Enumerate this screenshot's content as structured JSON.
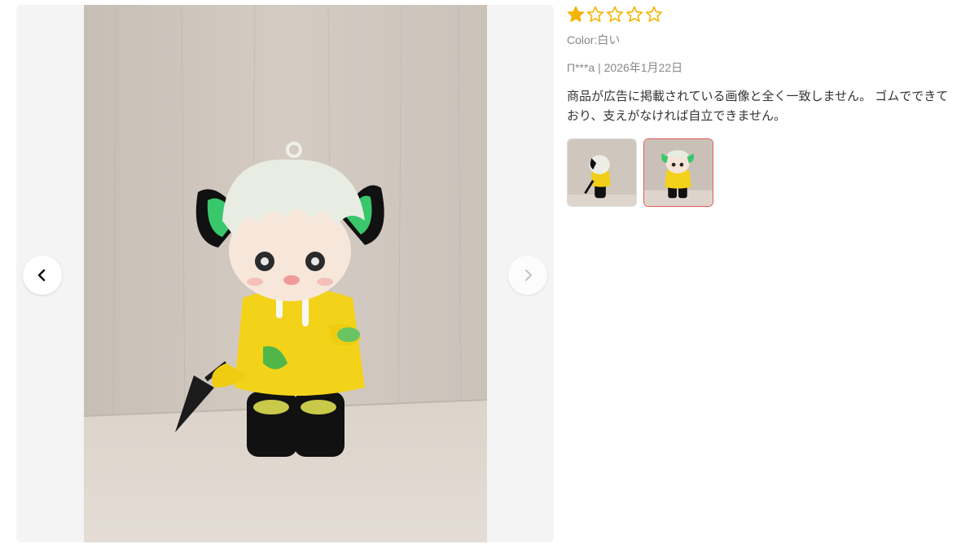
{
  "review": {
    "rating": 1,
    "max_rating": 5,
    "star_color": "#f5b400",
    "color_label": "Color:白い",
    "author_date": "П***а | 2026年1月22日",
    "text": "商品が広告に掲載されている画像と全く一致しません。 ゴムでできており、支えがなければ自立できません。",
    "thumbnails": [
      {
        "name": "side-view",
        "selected": false
      },
      {
        "name": "front-view",
        "selected": true
      }
    ]
  },
  "gallery": {
    "prev_icon": "chevron-left-icon",
    "next_icon": "chevron-right-icon",
    "accent_selected": "#e35b5b"
  }
}
